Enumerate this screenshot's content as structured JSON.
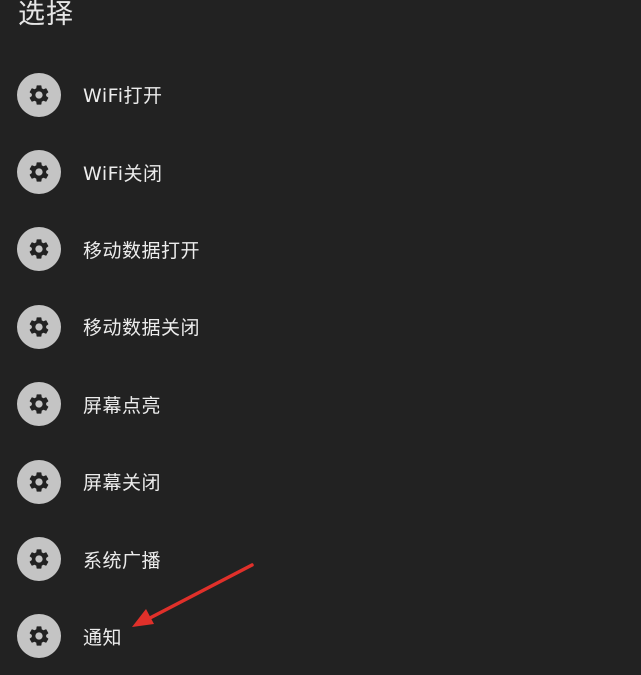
{
  "dialog": {
    "title": "选择"
  },
  "items": [
    {
      "label": "WiFi打开",
      "icon": "gear-icon"
    },
    {
      "label": "WiFi关闭",
      "icon": "gear-icon"
    },
    {
      "label": "移动数据打开",
      "icon": "gear-icon"
    },
    {
      "label": "移动数据关闭",
      "icon": "gear-icon"
    },
    {
      "label": "屏幕点亮",
      "icon": "gear-icon"
    },
    {
      "label": "屏幕关闭",
      "icon": "gear-icon"
    },
    {
      "label": "系统广播",
      "icon": "gear-icon"
    },
    {
      "label": "通知",
      "icon": "gear-icon"
    }
  ],
  "colors": {
    "background": "#222222",
    "icon_circle": "#c4c4c4",
    "gear": "#222222",
    "arrow": "#e0302a"
  }
}
